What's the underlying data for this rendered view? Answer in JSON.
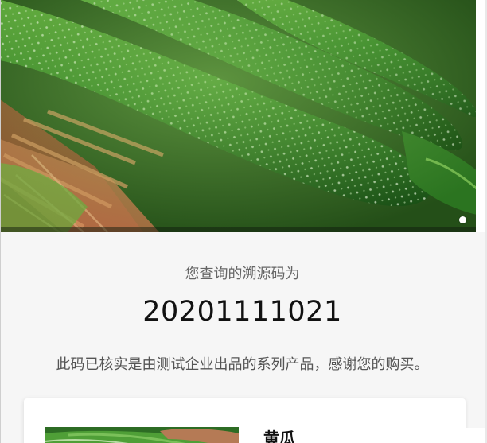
{
  "trace": {
    "query_label": "您查询的溯源码为",
    "code": "20201111021",
    "verify_message": "此码已核实是由测试企业出品的系列产品，感谢您的购买。"
  },
  "product": {
    "name": "黄瓜"
  },
  "carousel": {
    "current_slide": 1
  }
}
